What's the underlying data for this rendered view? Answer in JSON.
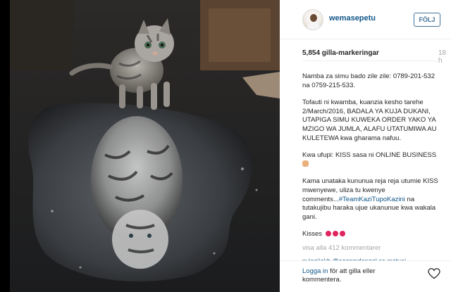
{
  "post": {
    "username": "wemasepetu",
    "follow_label": "FÖLJ",
    "likes": "5,854 gilla-markeringar",
    "time": "18 h",
    "caption": {
      "p1": "Namba za simu bado zile zile: 0789-201-532 na 0759-215-533.",
      "p2": "Tofauti ni kwamba, kuanzia kesho tarehe 2/March/2016, BADALA YA KUJA DUKANI, UTAPIGA SIMU KUWEKA ORDER YAKO YA MZIGO WA JUMLA, ALAFU UTATUMIWA AU KULETEWA kwa gharama nafuu.",
      "p3": "Kwa ufupi: KISS sasa ni ONLINE BUSINESS",
      "p4_a": "Kama unataka kununua reja reja utumie KISS mwenyewe, uliza tu kwenye comments...",
      "p4_tag": "#TeamKaziTupoKazini",
      "p4_b": " na tutakujibu haraka ujue ukanunue kwa wakala gani.",
      "p5": "Kisses"
    },
    "view_all_comments": "visa alla 412 kommentarer",
    "cut_comment": "nyiegiiokh @aazamdengel sa matuai",
    "login_link": "Logga in",
    "login_text": " för att gilla eller kommentera."
  },
  "icons": {
    "avatar": "profile-avatar",
    "hand": "raised-hand-emoji",
    "kiss": "kiss-mark-emoji",
    "heart": "heart-icon"
  },
  "colors": {
    "link": "#125688",
    "follow": "#3f729b",
    "muted": "#a5a7aa"
  }
}
